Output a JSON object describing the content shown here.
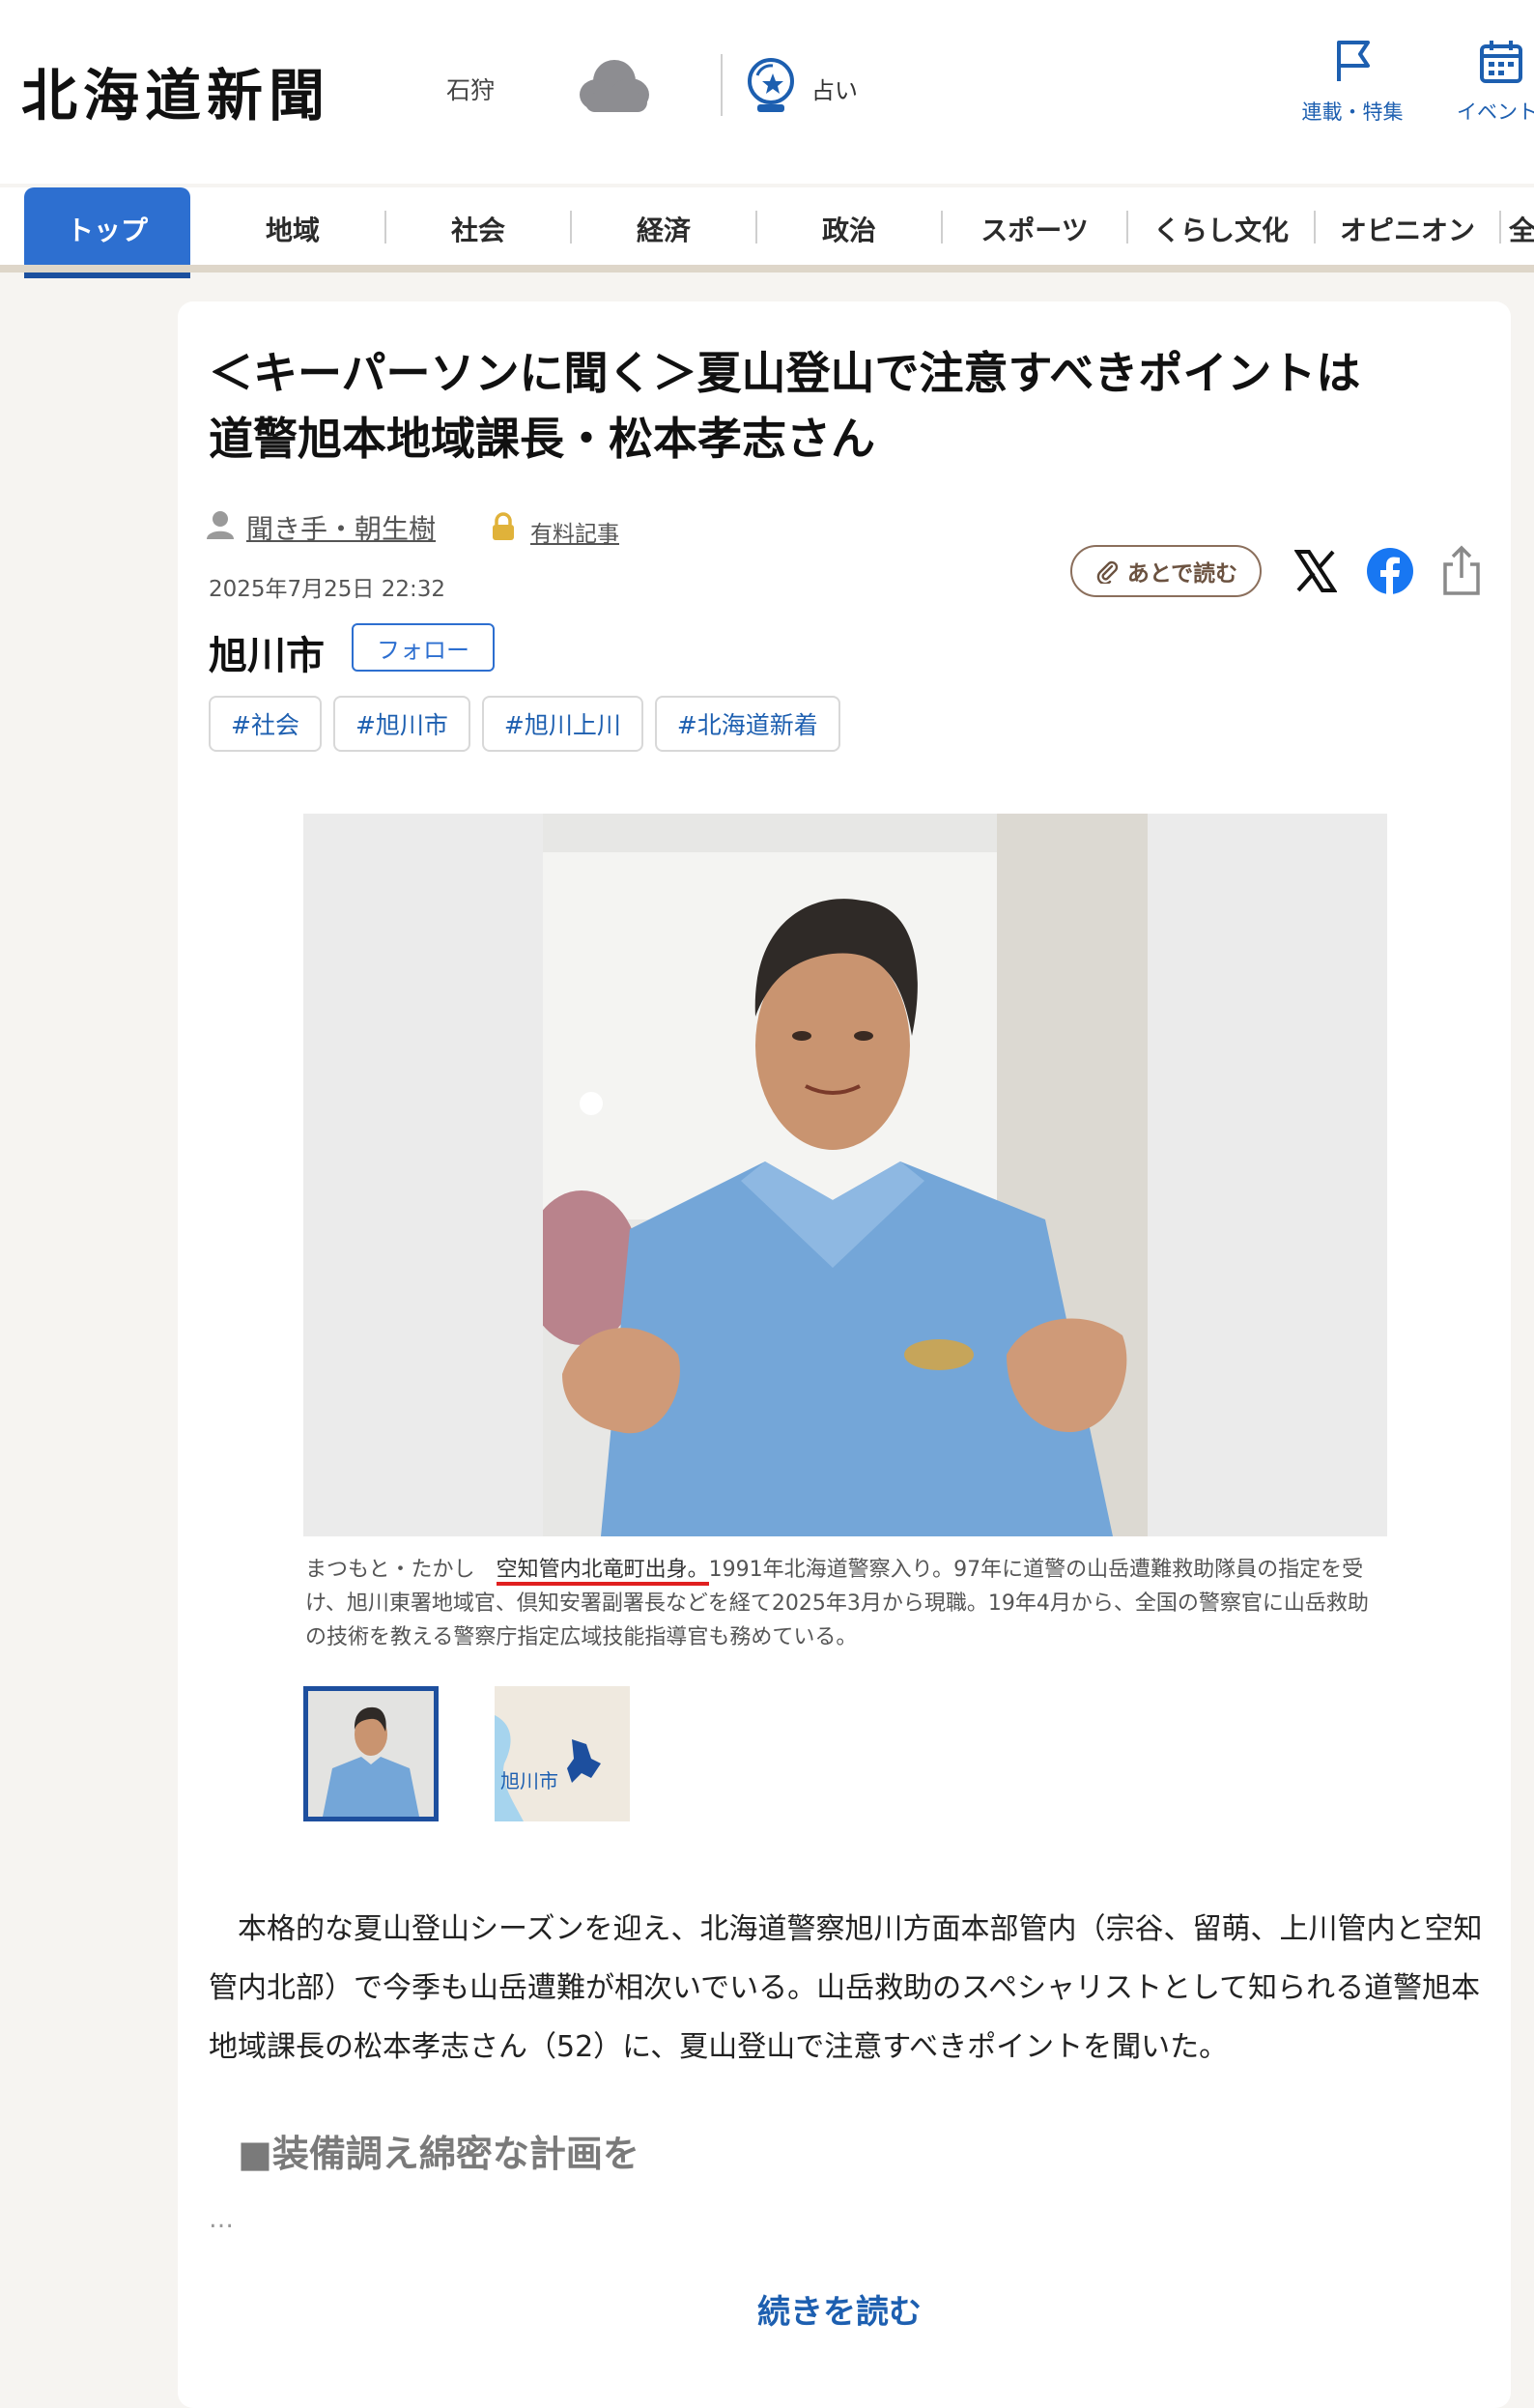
{
  "header": {
    "logo": "北海道新聞",
    "region": "石狩",
    "weather_icon": "cloud-icon",
    "fortune_label": "占い",
    "buttons": [
      {
        "label": "連載・特集",
        "icon": "flag-icon"
      },
      {
        "label": "イベント",
        "icon": "calendar-icon"
      }
    ]
  },
  "nav": {
    "tabs": [
      "トップ",
      "地域",
      "社会",
      "経済",
      "政治",
      "スポーツ",
      "くらし文化",
      "オピニオン",
      "全"
    ]
  },
  "article": {
    "title_line1": "＜キーパーソンに聞く＞夏山登山で注意すべきポイントは",
    "title_line2": "道警旭本地域課長・松本孝志さん",
    "author": "聞き手・朝生樹",
    "paid_label": "有料記事",
    "date": "2025年7月25日 22:32",
    "read_later": "あとで読む",
    "city": "旭川市",
    "follow": "フォロー",
    "tags": [
      "#社会",
      "#旭川市",
      "#旭川上川",
      "#北海道新着"
    ],
    "caption_prefix": "まつもと・たかし　",
    "caption_highlight": "空知管内北竜町出身。",
    "caption_rest": "1991年北海道警察入り。97年に道警の山岳遭難救助隊員の指定を受け、旭川東署地域官、倶知安署副署長などを経て2025年3月から現職。19年4月から、全国の警察官に山岳救助の技術を教える警察庁指定広域技能指導官も務めている。",
    "thumb2_label": "旭川市",
    "body": "本格的な夏山登山シーズンを迎え、北海道警察旭川方面本部管内（宗谷、留萌、上川管内と空知管内北部）で今季も山岳遭難が相次いでいる。山岳救助のスペシャリストとして知られる道警旭本地域課長の松本孝志さん（52）に、夏山登山で注意すべきポイントを聞いた。",
    "subhead": "■装備調え綿密な計画を",
    "ellipsis": "…",
    "read_more": "続きを読む"
  },
  "colors": {
    "accent": "#2d6fd0",
    "link": "#1d5fb0",
    "highlight": "#e02020"
  }
}
